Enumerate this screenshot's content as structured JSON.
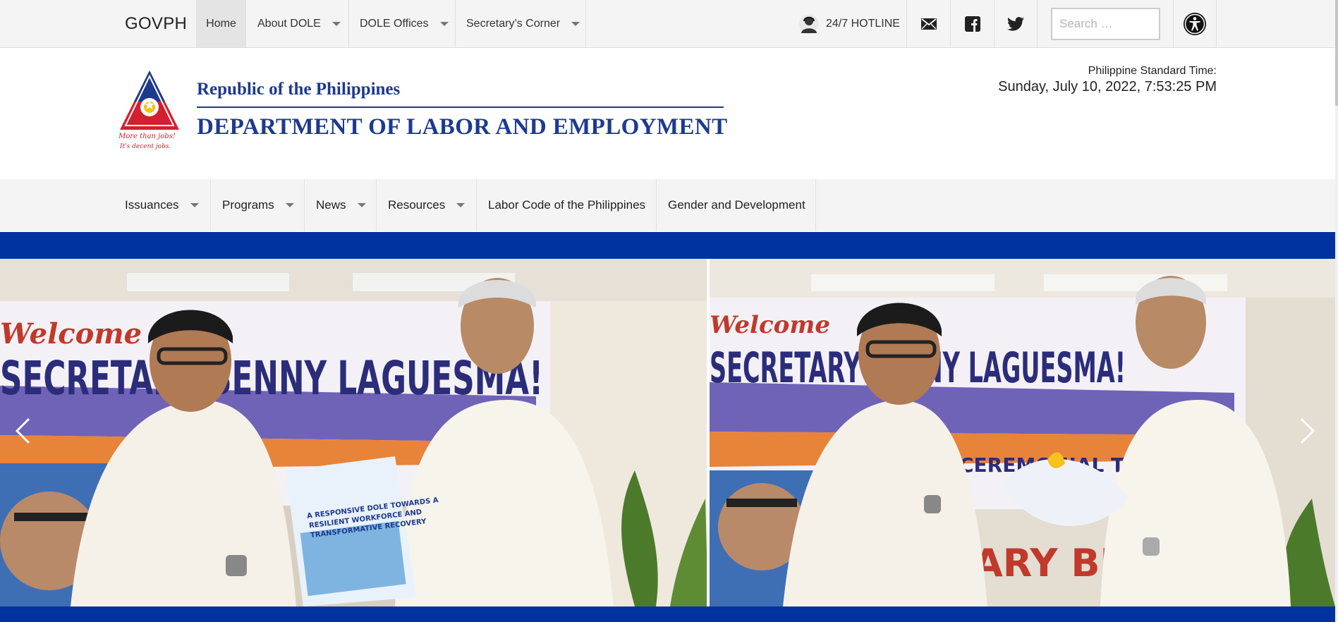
{
  "topbar": {
    "govph_label": "GOVPH",
    "nav": [
      {
        "label": "Home"
      },
      {
        "label": "About DOLE"
      },
      {
        "label": "DOLE Offices"
      },
      {
        "label": "Secretary’s Corner"
      }
    ],
    "hotline_label": "24/7 HOTLINE",
    "social_icons": [
      "mail-icon",
      "facebook-icon",
      "twitter-icon"
    ],
    "search_placeholder": "Search …",
    "accessibility_icon": "accessibility-icon"
  },
  "header": {
    "logo_lines": [
      "More than jobs!",
      "It's decent jobs."
    ],
    "title_top": "Republic of the Philippines",
    "title_main": "DEPARTMENT OF LABOR AND EMPLOYMENT",
    "pst_label": "Philippine Standard Time:",
    "pst_time": "Sunday, July 10, 2022, 7:53:25 PM"
  },
  "mainmenu": {
    "items": [
      {
        "label": "Issuances"
      },
      {
        "label": "Programs"
      },
      {
        "label": "News"
      },
      {
        "label": "Resources"
      },
      {
        "label": "Labor Code of the Philippines"
      },
      {
        "label": "Gender and Development"
      }
    ]
  },
  "slider": {
    "banner_words": [
      "Welcome",
      "SECRETARY BENNY LAGUESMA!",
      "CEREMONIAL TURNOVER OF DOLE"
    ],
    "document_title": "A RESPONSIVE DOLE TOWARDS A RESILIENT WORKFORCE AND TRANSFORMATIVE RECOVERY",
    "prev_icon": "chevron-left-icon",
    "next_icon": "chevron-right-icon"
  },
  "colors": {
    "brand_blue": "#0033a0",
    "title_blue": "#1d3a8f",
    "logo_red": "#d22030",
    "topbar_bg": "#f4f4f4"
  }
}
